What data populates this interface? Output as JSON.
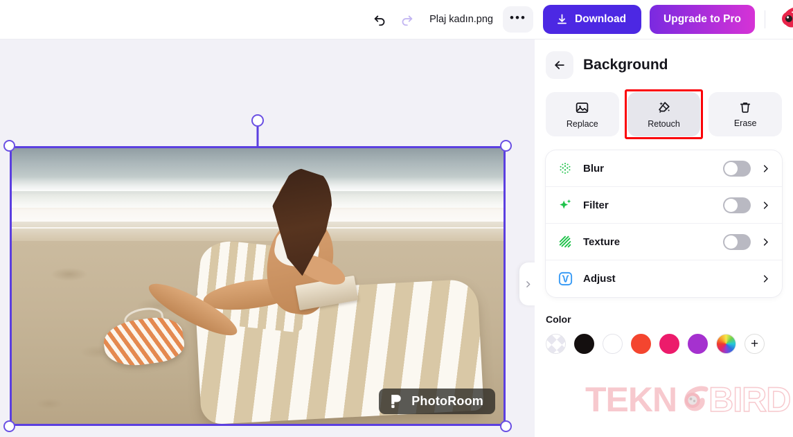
{
  "topbar": {
    "undo_icon": "undo-arrow-icon",
    "redo_icon": "redo-arrow-icon",
    "filename": "Plaj kadın.png",
    "more_label": "•••",
    "download_label": "Download",
    "upgrade_label": "Upgrade to Pro",
    "brand_logo": "teknobird-eye-logo"
  },
  "canvas": {
    "background_color": "#F2F1F7",
    "selection_color": "#5B3FE0",
    "photo_watermark": "PhotoRoom",
    "collapse_icon": "chevron-right-icon"
  },
  "panel": {
    "back_icon": "arrow-left-icon",
    "title": "Background",
    "actions": [
      {
        "label": "Replace",
        "icon": "image-icon",
        "selected": false,
        "highlighted": false
      },
      {
        "label": "Retouch",
        "icon": "retouch-eraser-icon",
        "selected": true,
        "highlighted": true
      },
      {
        "label": "Erase",
        "icon": "trash-icon",
        "selected": false,
        "highlighted": false
      }
    ],
    "rows": [
      {
        "label": "Blur",
        "icon": "blur-dots-icon",
        "has_toggle": true,
        "toggle_on": false
      },
      {
        "label": "Filter",
        "icon": "sparkle-icon",
        "has_toggle": true,
        "toggle_on": false
      },
      {
        "label": "Texture",
        "icon": "texture-stripes-icon",
        "has_toggle": true,
        "toggle_on": false
      },
      {
        "label": "Adjust",
        "icon": "adjust-curve-icon",
        "has_toggle": false,
        "toggle_on": false
      }
    ],
    "color_section_label": "Color",
    "swatches": [
      {
        "name": "transparent",
        "value": "transparent"
      },
      {
        "name": "black",
        "value": "#140F0F"
      },
      {
        "name": "white",
        "value": "#FFFFFF"
      },
      {
        "name": "red",
        "value": "#F4452F"
      },
      {
        "name": "pink",
        "value": "#EC1B6B"
      },
      {
        "name": "purple",
        "value": "#A531CF"
      },
      {
        "name": "rainbow",
        "value": "rainbow"
      }
    ],
    "add_swatch_label": "+"
  },
  "watermark": {
    "text_solid": "TEKN",
    "logo": "teknobird-eye-logo",
    "text_outline": "BIRD",
    "color": "#F7C9CE"
  }
}
